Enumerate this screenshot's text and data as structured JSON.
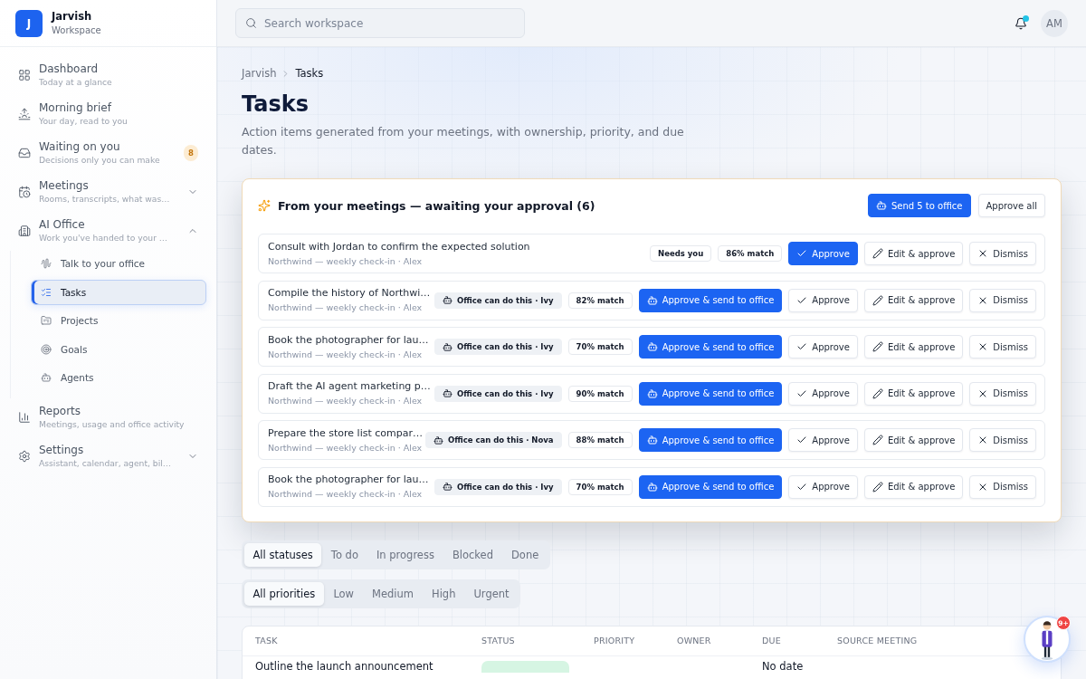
{
  "sidebar": {
    "brand": {
      "initial": "J",
      "name": "Jarvish",
      "subtitle": "Workspace"
    },
    "items": [
      {
        "title": "Dashboard",
        "subtitle": "Today at a glance",
        "selected": false
      },
      {
        "title": "Morning brief",
        "subtitle": "Your day, read to you",
        "selected": false
      },
      {
        "title": "Waiting on you",
        "subtitle": "Decisions only you can make",
        "badge": "8",
        "selected": false
      },
      {
        "title": "Meetings",
        "subtitle": "Rooms, transcripts, what was…",
        "expanded": false,
        "selected": false
      },
      {
        "title": "AI Office",
        "subtitle": "Work you've handed to your …",
        "expanded": true,
        "selected": false,
        "children": [
          {
            "title": "Talk to your office",
            "selected": false
          },
          {
            "title": "Tasks",
            "selected": true
          },
          {
            "title": "Projects",
            "selected": false
          },
          {
            "title": "Goals",
            "selected": false
          },
          {
            "title": "Agents",
            "selected": false
          }
        ]
      },
      {
        "title": "Reports",
        "subtitle": "Meetings, usage and office activity",
        "selected": false
      },
      {
        "title": "Settings",
        "subtitle": "Assistant, calendar, agent, bil…",
        "expanded": false,
        "selected": false
      }
    ]
  },
  "topbar": {
    "search": {
      "placeholder": "Search workspace"
    },
    "notifications": {
      "unread": true
    },
    "avatar": "AM"
  },
  "page": {
    "breadcrumb": [
      "Jarvish",
      "Tasks"
    ],
    "title": "Tasks",
    "description": "Action items generated from your meetings, with ownership, priority, and due dates."
  },
  "approvals": {
    "title": "From your meetings — awaiting your approval (6)",
    "buttons": [
      {
        "kind": "send",
        "label": "Send 5 to office",
        "primary": true
      },
      {
        "kind": "approve_all",
        "label": "Approve all",
        "primary": false
      }
    ],
    "rows": [
      {
        "title": "Consult with Jordan to confirm the expected solution",
        "source": "Northwind — weekly check-in · Alex",
        "badge": {
          "kind": "needs_you",
          "label": "Needs you"
        },
        "match": "86% match",
        "actions": [
          {
            "kind": "approve",
            "label": "Approve",
            "primary": true
          },
          {
            "kind": "edit",
            "label": "Edit & approve",
            "primary": false
          },
          {
            "kind": "dismiss",
            "label": "Dismiss",
            "primary": false
          }
        ]
      },
      {
        "title": "Compile the history of Northwi…",
        "source": "Northwind — weekly check-in · Alex",
        "badge": {
          "kind": "office",
          "label": "Office can do this · Ivy"
        },
        "match": "82% match",
        "actions": [
          {
            "kind": "approve_send",
            "label": "Approve & send to office",
            "primary": true
          },
          {
            "kind": "approve",
            "label": "Approve",
            "primary": false
          },
          {
            "kind": "edit",
            "label": "Edit & approve",
            "primary": false
          },
          {
            "kind": "dismiss",
            "label": "Dismiss",
            "primary": false
          }
        ]
      },
      {
        "title": "Book the photographer for lau…",
        "source": "Northwind — weekly check-in · Alex",
        "badge": {
          "kind": "office",
          "label": "Office can do this · Ivy"
        },
        "match": "70% match",
        "actions": [
          {
            "kind": "approve_send",
            "label": "Approve & send to office",
            "primary": true
          },
          {
            "kind": "approve",
            "label": "Approve",
            "primary": false
          },
          {
            "kind": "edit",
            "label": "Edit & approve",
            "primary": false
          },
          {
            "kind": "dismiss",
            "label": "Dismiss",
            "primary": false
          }
        ]
      },
      {
        "title": "Draft the AI agent marketing p…",
        "source": "Northwind — weekly check-in · Alex",
        "badge": {
          "kind": "office",
          "label": "Office can do this · Ivy"
        },
        "match": "90% match",
        "actions": [
          {
            "kind": "approve_send",
            "label": "Approve & send to office",
            "primary": true
          },
          {
            "kind": "approve",
            "label": "Approve",
            "primary": false
          },
          {
            "kind": "edit",
            "label": "Edit & approve",
            "primary": false
          },
          {
            "kind": "dismiss",
            "label": "Dismiss",
            "primary": false
          }
        ]
      },
      {
        "title": "Prepare the store list compar…",
        "source": "Northwind — weekly check-in · Alex",
        "badge": {
          "kind": "office",
          "label": "Office can do this · Nova"
        },
        "match": "88% match",
        "actions": [
          {
            "kind": "approve_send",
            "label": "Approve & send to office",
            "primary": true
          },
          {
            "kind": "approve",
            "label": "Approve",
            "primary": false
          },
          {
            "kind": "edit",
            "label": "Edit & approve",
            "primary": false
          },
          {
            "kind": "dismiss",
            "label": "Dismiss",
            "primary": false
          }
        ]
      },
      {
        "title": "Book the photographer for lau…",
        "source": "Northwind — weekly check-in · Alex",
        "badge": {
          "kind": "office",
          "label": "Office can do this · Ivy"
        },
        "match": "70% match",
        "actions": [
          {
            "kind": "approve_send",
            "label": "Approve & send to office",
            "primary": true
          },
          {
            "kind": "approve",
            "label": "Approve",
            "primary": false
          },
          {
            "kind": "edit",
            "label": "Edit & approve",
            "primary": false
          },
          {
            "kind": "dismiss",
            "label": "Dismiss",
            "primary": false
          }
        ]
      }
    ]
  },
  "filters": [
    {
      "options": [
        {
          "label": "All statuses",
          "selected": true
        },
        {
          "label": "To do",
          "selected": false
        },
        {
          "label": "In progress",
          "selected": false
        },
        {
          "label": "Blocked",
          "selected": false
        },
        {
          "label": "Done",
          "selected": false
        }
      ]
    },
    {
      "options": [
        {
          "label": "All priorities",
          "selected": true
        },
        {
          "label": "Low",
          "selected": false
        },
        {
          "label": "Medium",
          "selected": false
        },
        {
          "label": "High",
          "selected": false
        },
        {
          "label": "Urgent",
          "selected": false
        }
      ]
    }
  ],
  "table": {
    "columns": [
      "TASK",
      "STATUS",
      "PRIORITY",
      "OWNER",
      "DUE",
      "SOURCE MEETING"
    ],
    "rows": [
      {
        "task": "Outline the launch announcement",
        "status": {
          "color": "#d6f5e3"
        },
        "due": "No date"
      }
    ]
  },
  "assistant": {
    "badge": "9+"
  }
}
